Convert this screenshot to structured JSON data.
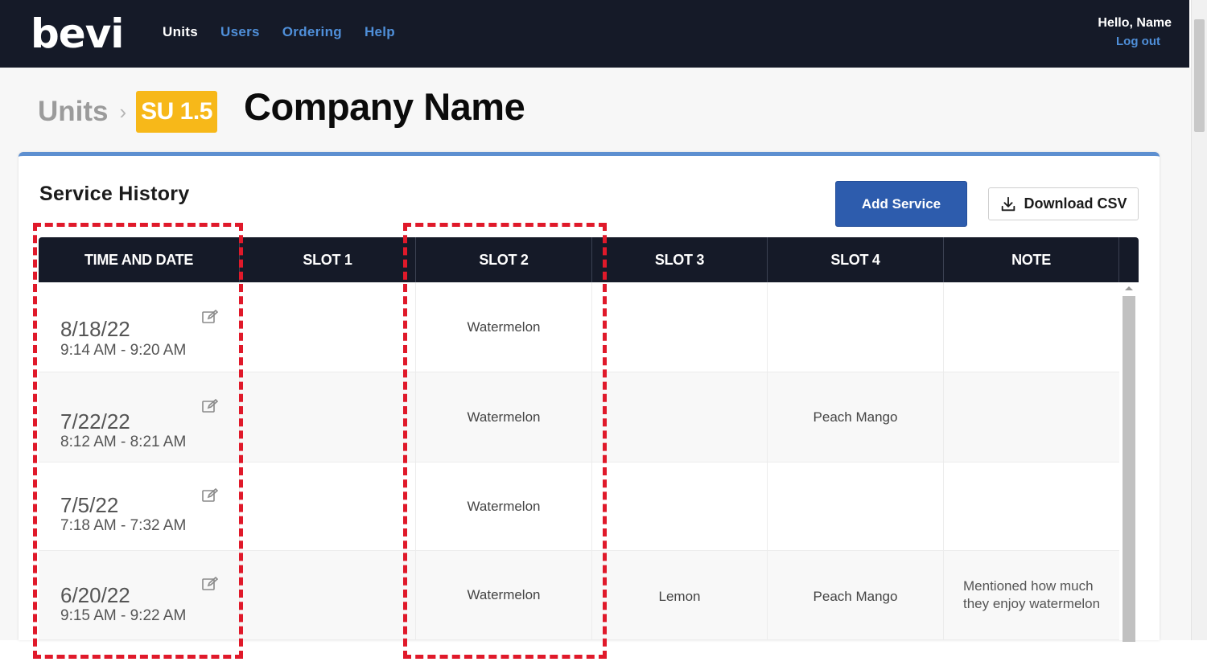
{
  "app": {
    "logo_text": "bevi"
  },
  "nav": {
    "items": [
      {
        "label": "Units",
        "active": true
      },
      {
        "label": "Users",
        "active": false
      },
      {
        "label": "Ordering",
        "active": false
      },
      {
        "label": "Help",
        "active": false
      }
    ]
  },
  "user": {
    "greeting": "Hello, Name",
    "logout_label": "Log out"
  },
  "breadcrumb": {
    "root": "Units",
    "separator": "›",
    "badge": "SU 1.5"
  },
  "page": {
    "title": "Company Name"
  },
  "service_history": {
    "title": "Service History",
    "add_button": "Add Service",
    "download_button": "Download CSV",
    "columns": [
      "TIME AND DATE",
      "SLOT 1",
      "SLOT 2",
      "SLOT 3",
      "SLOT 4",
      "NOTE"
    ],
    "rows": [
      {
        "date": "8/18/22",
        "time": "9:14 AM - 9:20 AM",
        "slot1": "",
        "slot2": "Watermelon",
        "slot3": "",
        "slot4": "",
        "note": ""
      },
      {
        "date": "7/22/22",
        "time": "8:12 AM - 8:21 AM",
        "slot1": "",
        "slot2": "Watermelon",
        "slot3": "",
        "slot4": "Peach Mango",
        "note": ""
      },
      {
        "date": "7/5/22",
        "time": "7:18 AM - 7:32 AM",
        "slot1": "",
        "slot2": "Watermelon",
        "slot3": "",
        "slot4": "",
        "note": ""
      },
      {
        "date": "6/20/22",
        "time": "9:15 AM - 9:22 AM",
        "slot1": "",
        "slot2": "Watermelon",
        "slot3": "Lemon",
        "slot4": "Peach Mango",
        "note_line1": "Mentioned how much",
        "note_line2": "they enjoy watermelon"
      }
    ]
  },
  "colors": {
    "nav_bg": "#151a28",
    "accent_blue": "#2d5cad",
    "badge_yellow": "#f7b819",
    "highlight_red": "#e0192a"
  },
  "icons": {
    "edit": "edit-icon",
    "download": "download-icon"
  }
}
